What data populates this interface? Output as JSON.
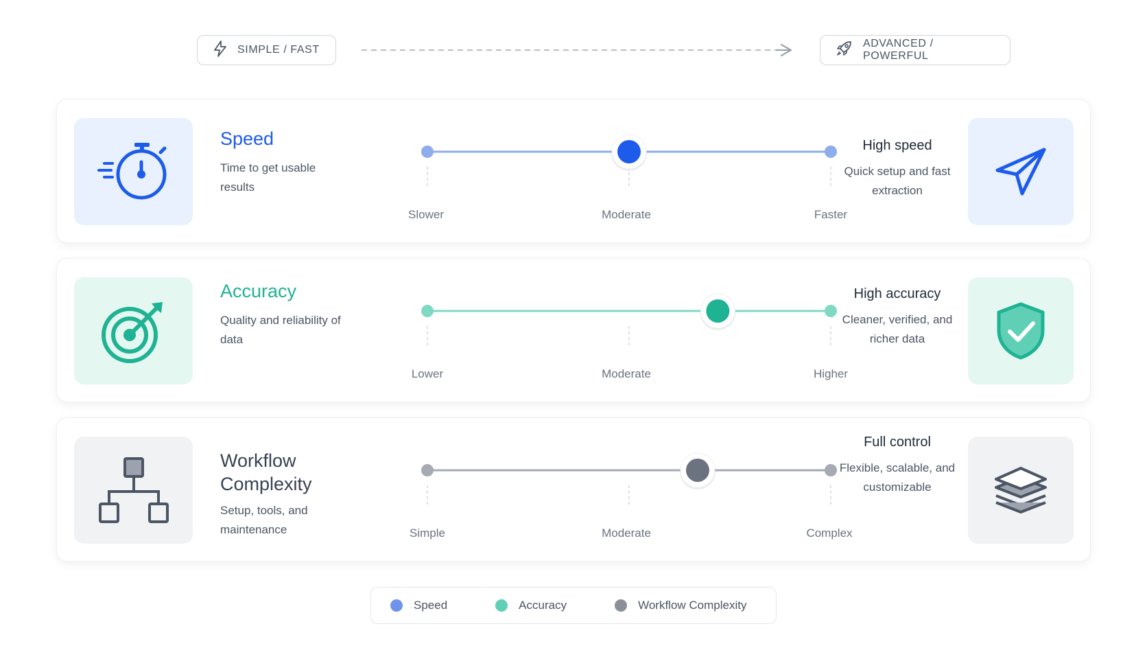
{
  "scale": {
    "left_label": "SIMPLE / FAST",
    "left_icon": "lightning-icon",
    "right_label": "ADVANCED / POWERFUL",
    "right_icon": "rocket-icon"
  },
  "rows": [
    {
      "title": "Speed",
      "description": "Time to get usable results",
      "icon": "stopwatch-icon",
      "color": "#1d5bea",
      "track_color": "#8fadeb",
      "tile_bg": "#e8f1fd",
      "ticks": [
        "Slower",
        "Moderate",
        "Faster"
      ],
      "position": 0.5,
      "summary_title": "High speed",
      "summary_desc": "Quick setup and fast extraction",
      "right_icon": "paper-plane-icon"
    },
    {
      "title": "Accuracy",
      "description": "Quality and reliability of data",
      "icon": "target-icon",
      "color": "#1fb293",
      "track_color": "#7fd9c3",
      "tile_bg": "#e4f8f1",
      "ticks": [
        "Lower",
        "Moderate",
        "Higher"
      ],
      "position": 0.72,
      "summary_title": "High accuracy",
      "summary_desc": "Cleaner, verified, and richer data",
      "right_icon": "shield-check-icon"
    },
    {
      "title": "Workflow Complexity",
      "description": "Setup, tools, and maintenance",
      "icon": "hierarchy-icon",
      "color": "#6b7280",
      "track_color": "#a5aab3",
      "tile_bg": "#f1f2f4",
      "ticks": [
        "Simple",
        "Moderate",
        "Complex"
      ],
      "position": 0.67,
      "summary_title": "Full control",
      "summary_desc": "Flexible, scalable, and customizable",
      "right_icon": "layers-icon"
    }
  ],
  "legend": [
    {
      "label": "Speed",
      "color": "#6f93ea"
    },
    {
      "label": "Accuracy",
      "color": "#5fd0b6"
    },
    {
      "label": "Workflow Complexity",
      "color": "#8a8f98"
    }
  ]
}
